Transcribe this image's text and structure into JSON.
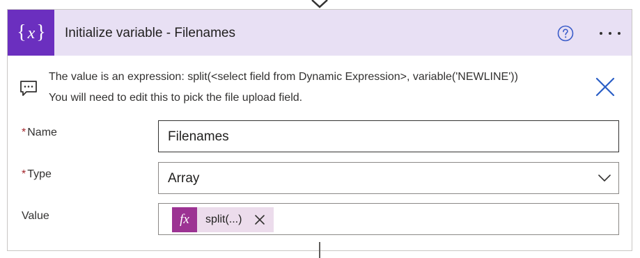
{
  "card": {
    "title": "Initialize variable - Filenames",
    "icon": "variable-icon",
    "accent_color": "#6b2fbf",
    "header_background": "#e8e0f4",
    "help_icon": "help-circle-icon",
    "more_icon": "more-options-icon"
  },
  "info": {
    "line1": "The value is an expression: split(<select field from Dynamic Expression>, variable('NEWLINE'))",
    "line2": "You will need to edit this to pick the file upload field.",
    "icon": "comment-icon",
    "dismiss_icon": "dismiss-icon"
  },
  "fields": {
    "name": {
      "required_mark": "*",
      "label": "Name",
      "value": "Filenames"
    },
    "type": {
      "required_mark": "*",
      "label": "Type",
      "selected": "Array",
      "icon": "chevron-down-icon"
    },
    "value": {
      "label": "Value",
      "token": {
        "icon_label": "fx",
        "label": "split(...)",
        "color": "#9c3393",
        "background": "#ecdcec",
        "remove_icon": "close-icon"
      }
    }
  }
}
